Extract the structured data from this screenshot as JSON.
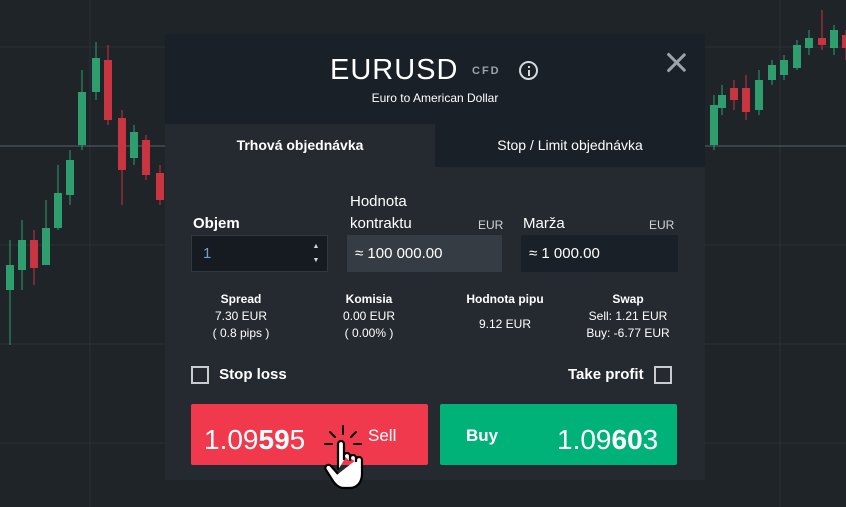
{
  "dialog": {
    "symbol": "EURUSD",
    "badge": "CFD",
    "subtitle": "Euro to American Dollar",
    "close_icon": "close-icon",
    "info_icon": "info-icon"
  },
  "tabs": [
    {
      "label": "Trhová objednávka",
      "active": true
    },
    {
      "label": "Stop / Limit objednávka",
      "active": false
    }
  ],
  "fields": {
    "volume": {
      "label": "Objem",
      "value": "1"
    },
    "contract_value": {
      "label_line1": "Hodnota",
      "label_line2": "kontraktu",
      "currency": "EUR",
      "value": "≈ 100 000.00"
    },
    "margin": {
      "label": "Marža",
      "currency": "EUR",
      "value": "≈ 1 000.00"
    }
  },
  "stats": {
    "spread": {
      "title": "Spread",
      "line1": "7.30 EUR",
      "line2": "( 0.8 pips )"
    },
    "commission": {
      "title": "Komisia",
      "line1": "0.00 EUR",
      "line2": "( 0.00% )"
    },
    "pip_value": {
      "title": "Hodnota pipu",
      "line1": "9.12 EUR"
    },
    "swap": {
      "title": "Swap",
      "line1": "Sell: 1.21 EUR",
      "line2": "Buy: -6.77 EUR"
    }
  },
  "checkboxes": {
    "stop_loss": {
      "label": "Stop loss",
      "checked": false
    },
    "take_profit": {
      "label": "Take profit",
      "checked": false
    }
  },
  "sell": {
    "label": "Sell",
    "price_prefix": "1.09",
    "price_big": "59",
    "price_suffix": "5",
    "color": "#f0394c"
  },
  "buy": {
    "label": "Buy",
    "price_prefix": "1.09",
    "price_big": "60",
    "price_suffix": "3",
    "color": "#00b277"
  },
  "colors": {
    "bull": "#2e9e6e",
    "bear": "#c8343f",
    "panel": "#252a30",
    "header": "#1a2027"
  }
}
